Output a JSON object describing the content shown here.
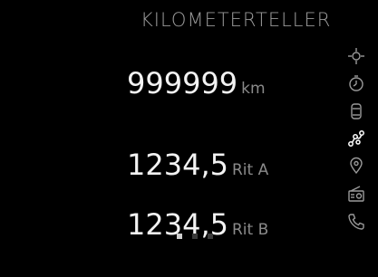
{
  "header": {
    "title": "KILOMETERTELLER"
  },
  "odometer": {
    "value": "999999",
    "unit": "km"
  },
  "trip_a": {
    "value": "1234,5",
    "label": "Rit A"
  },
  "trip_b": {
    "value": "1234,5",
    "label": "Rit B"
  },
  "sidebar": {
    "icons": [
      {
        "name": "navigation-crosshair-icon"
      },
      {
        "name": "clock-icon"
      },
      {
        "name": "car-icon"
      },
      {
        "name": "trip-route-icon",
        "active": true
      },
      {
        "name": "location-pin-icon"
      },
      {
        "name": "radio-icon"
      },
      {
        "name": "phone-icon"
      }
    ]
  },
  "pager": {
    "count": 3,
    "active_index": 0
  },
  "colors": {
    "background": "#000000",
    "text": "#f2f2f2",
    "muted": "#8a8a8a",
    "icon": "#9a9a9a",
    "active_icon": "#ffffff"
  }
}
